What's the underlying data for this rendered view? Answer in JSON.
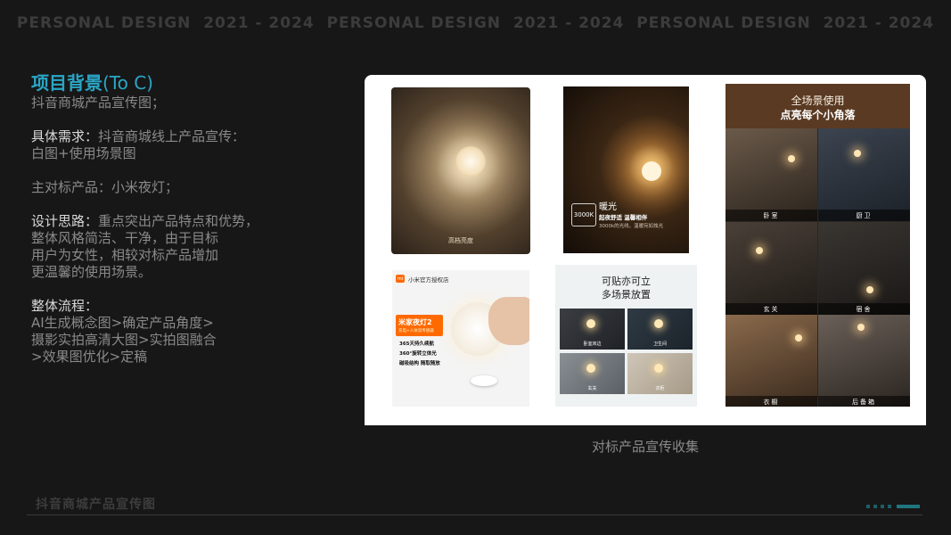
{
  "banner": [
    "PERSONAL DESIGN",
    "2021 - 2024",
    "PERSONAL DESIGN",
    "2021 - 2024",
    "PERSONAL DESIGN",
    "2021 - 2024"
  ],
  "intro": {
    "title": "项目背景",
    "title_suffix": "(To C)",
    "desc": "抖音商城产品宣传图；"
  },
  "requirements": {
    "label": "具体需求：",
    "lines": [
      "抖音商城线上产品宣传：",
      "白图+使用场景图"
    ]
  },
  "benchmark": {
    "text": "主对标产品：小米夜灯；"
  },
  "approach": {
    "label": "设计思路：",
    "lines": [
      "重点突出产品特点和优势，",
      "整体风格简洁、干净，由于目标",
      "用户为女性，相较对标产品增加",
      "更温馨的使用场景。"
    ]
  },
  "process": {
    "label": "整体流程：",
    "lines": [
      "AI生成概念图>确定产品角度>",
      "摄影实拍高清大图>实拍图融合",
      ">效果图优化>定稿"
    ]
  },
  "gallery": {
    "photo1": {
      "caption": "高档亮度"
    },
    "photo2": {
      "badge": "3000K",
      "heading": "暖光",
      "line1": "起夜舒适 温馨相伴",
      "line2": "3000k的光线，温暖宛如烛光"
    },
    "photo3": {
      "store_logo": "mi",
      "store": "小米官方授权店",
      "product": "米家夜灯2",
      "product_sub": "充电+人体双传感器",
      "feature1": "365天持久续航",
      "feature2": "360°旋转立体光",
      "feature3": "磁吸结构 随取随放"
    },
    "photo4": {
      "heading1": "可贴亦可立",
      "heading2": "多场景放置",
      "tiles": [
        "卧室床边",
        "卫生间",
        "玄关",
        "衣柜"
      ]
    },
    "photo5": {
      "heading1": "全场景使用",
      "heading2": "点亮每个小角落",
      "labels": [
        "卧室",
        "厨卫",
        "玄关",
        "宿舍",
        "衣橱",
        "后备箱"
      ]
    },
    "caption": "对标产品宣传收集"
  },
  "footer": {
    "title": "抖音商城产品宣传图"
  },
  "colors": {
    "background": "#171717",
    "accent": "#2aa6c6",
    "muted_text": "#8a8a8a",
    "label_text": "#d9d9d9"
  }
}
